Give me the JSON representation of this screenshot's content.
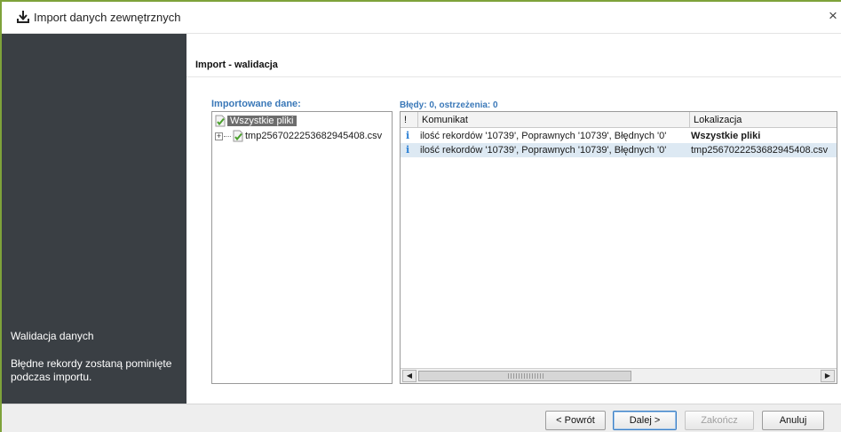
{
  "window": {
    "title": "Import danych zewnętrznych",
    "close_glyph": "×",
    "title_icon": "download-icon"
  },
  "sidebar": {
    "step_title": "Walidacja danych",
    "step_description": "Błędne rekordy zostaną pominięte podczas importu."
  },
  "main": {
    "step_header": "Import - walidacja",
    "imported_label": "Importowane dane:",
    "errors_label": "Błędy: 0, ostrzeżenia: 0",
    "tree": {
      "root": "Wszystkie pliki",
      "expander": "+",
      "files": [
        "tmp2567022253682945408.csv"
      ]
    },
    "grid": {
      "columns": [
        "!",
        "Komunikat",
        "Lokalizacja"
      ],
      "rows": [
        {
          "icon": "i",
          "message": "ilość rekordów '10739', Poprawnych '10739', Błędnych '0'",
          "location": "Wszystkie pliki",
          "location_bold": true
        },
        {
          "icon": "i",
          "message": "ilość rekordów '10739', Poprawnych '10739', Błędnych '0'",
          "location": "tmp2567022253682945408.csv",
          "location_bold": false
        }
      ]
    }
  },
  "footer": {
    "back": "< Powrót",
    "next": "Dalej >",
    "finish": "Zakończ",
    "cancel": "Anuluj"
  },
  "colors": {
    "sidebar_bg": "#3a3f44",
    "accent_label": "#3a78b8",
    "selected_row": "#dde9f3",
    "window_border": "#7ea23a"
  }
}
